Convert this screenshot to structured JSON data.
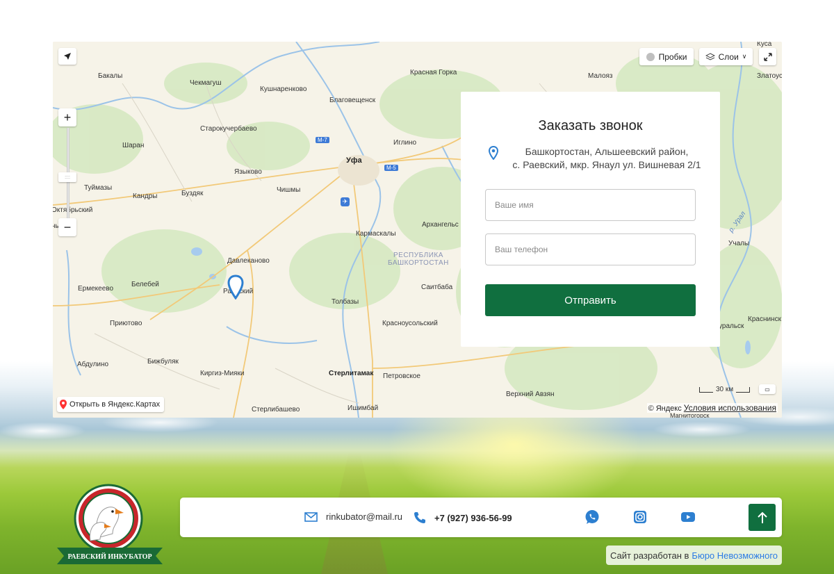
{
  "map": {
    "controls": {
      "traffic_label": "Пробки",
      "layers_label": "Слои",
      "open_yandex_label": "Открыть в Яндекс.Картах",
      "scale_label": "30 км",
      "copyright_label": "© Яндекс",
      "terms_label": "Условия использования"
    },
    "labels": {
      "bakaly": "Бакалы",
      "chekmagush": "Чекмагуш",
      "kushnarenkovo": "Кушнаренково",
      "krasnaya_gorka": "Красная Горка",
      "maloyaz": "Малояз",
      "kusa": "Куса",
      "zlatoust": "Златоуст",
      "blagoveshchensk": "Благовещенск",
      "starokuchergan": "Старокучербаево",
      "sharan": "Шаран",
      "iglino": "Иглино",
      "ufa": "Уфа",
      "m7": "М-7",
      "m5": "М-5",
      "yazykovo": "Языково",
      "tuymazy": "Туймазы",
      "buzdyak": "Буздяк",
      "chishmy": "Чишмы",
      "kandry": "Кандры",
      "oktyabrsky": "Октябрьский",
      "ny": "ны",
      "karmaskaly": "Кармаскалы",
      "arkhangelskoe": "Архангельс",
      "region": "РЕСПУБЛИКА\nБАШКОРТОСТАН",
      "ural_river": "р. Урал",
      "uchaly": "Учалы",
      "davlekanovo": "Давлеканово",
      "ermekeevo": "Ермекеево",
      "belebey": "Белебей",
      "raevsky": "Раевский",
      "saitbaba": "Саитбаба",
      "tolbazy": "Толбазы",
      "priyutovo": "Приютово",
      "krasnousolsky": "Красноусольский",
      "uralsk": "уральск",
      "krasninsk": "Краснинск",
      "abdulino": "Абдулино",
      "bizhbulyak": "Бижбуляк",
      "kirgiz_miyaki": "Киргиз-Мияки",
      "sterlitamak": "Стерлитамак",
      "petrovskoe": "Петровское",
      "verkhny_avzyan": "Верхний Авзян",
      "sterlibashevo": "Стерлибашево",
      "ishimbay": "Ишимбай",
      "magnitogorsk": "Магнитогорск"
    }
  },
  "form": {
    "title": "Заказать звонок",
    "address_line1": "Башкортостан, Альшеевский район,",
    "address_line2": "с. Раевский, мкр. Янаул ул. Вишневая 2/1",
    "name_placeholder": "Ваше имя",
    "phone_placeholder": "Ваш телефон",
    "submit_label": "Отправить"
  },
  "footer": {
    "email": "rinkubator@mail.ru",
    "phone": "+7 (927) 936-56-99",
    "credit_prefix": "Сайт разработан в",
    "credit_link": "Бюро Невозможного"
  },
  "logo": {
    "text": "РАЕВСКИЙ ИНКУБАТОР"
  },
  "colors": {
    "accent_green": "#106f3f",
    "link_blue": "#2c7be5",
    "icon_blue": "#2d7fd0",
    "credit_bg": "#e6f1d9"
  },
  "icons": {
    "email": "mail-icon",
    "phone": "phone-icon",
    "whatsapp": "whatsapp-icon",
    "instagram": "instagram-icon",
    "youtube": "youtube-icon",
    "scroll_top": "arrow-up-icon",
    "location": "map-pin-icon"
  }
}
